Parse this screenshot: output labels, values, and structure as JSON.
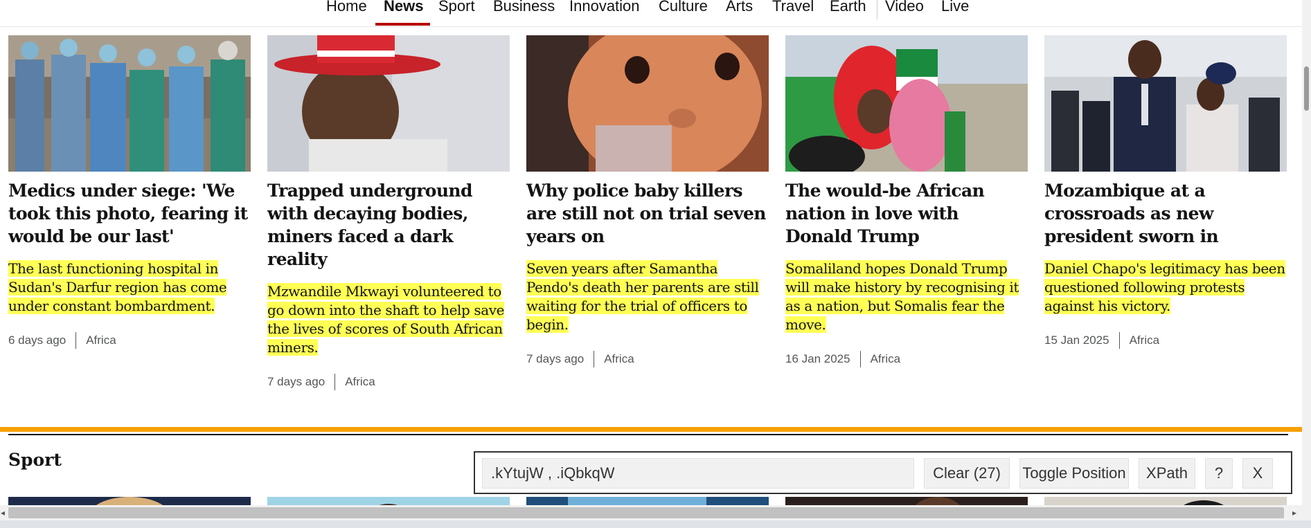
{
  "nav": {
    "items": [
      "Home",
      "News",
      "Sport",
      "Business",
      "Innovation",
      "Culture",
      "Arts",
      "Travel",
      "Earth",
      "Video",
      "Live"
    ],
    "active": "News"
  },
  "articles": [
    {
      "headline": "Medics under siege: 'We took this photo, fearing it would be our last'",
      "summary": "The last functioning hospital in Sudan's Darfur region has come under constant bombardment.",
      "time": "6 days ago",
      "category": "Africa",
      "image": "medics-in-scrubs-photo"
    },
    {
      "headline": "Trapped underground with decaying bodies, miners faced a dark reality",
      "summary": "Mzwandile Mkwayi volunteered to go down into the shaft to help save the lives of scores of South African miners.",
      "time": "7 days ago",
      "category": "Africa",
      "image": "man-in-red-hat-photo"
    },
    {
      "headline": "Why police baby killers are still not on trial seven years on",
      "summary": "Seven years after Samantha Pendo's death her parents are still waiting for the trial of officers to begin.",
      "time": "7 days ago",
      "category": "Africa",
      "image": "baby-portrait-photo"
    },
    {
      "headline": "The would-be African nation in love with Donald Trump",
      "summary": "Somaliland hopes Donald Trump will make history by recognising it as a nation, but Somalis fear the move.",
      "time": "16 Jan 2025",
      "category": "Africa",
      "image": "women-with-flags-photo"
    },
    {
      "headline": "Mozambique at a crossroads as new president sworn in",
      "summary": "Daniel Chapo's legitimacy has been questioned following protests against his victory.",
      "time": "15 Jan 2025",
      "category": "Africa",
      "image": "president-and-wife-photo"
    }
  ],
  "sport": {
    "title": "Sport"
  },
  "selector_gadget": {
    "query": ".kYtujW , .iQbkqW",
    "clear_label": "Clear (27)",
    "toggle_label": "Toggle Position",
    "xpath_label": "XPath",
    "help_label": "?",
    "close_label": "X"
  },
  "colors": {
    "highlight": "#ffff55",
    "nav_active": "#b80000",
    "sport_accent": "#f7a000"
  }
}
